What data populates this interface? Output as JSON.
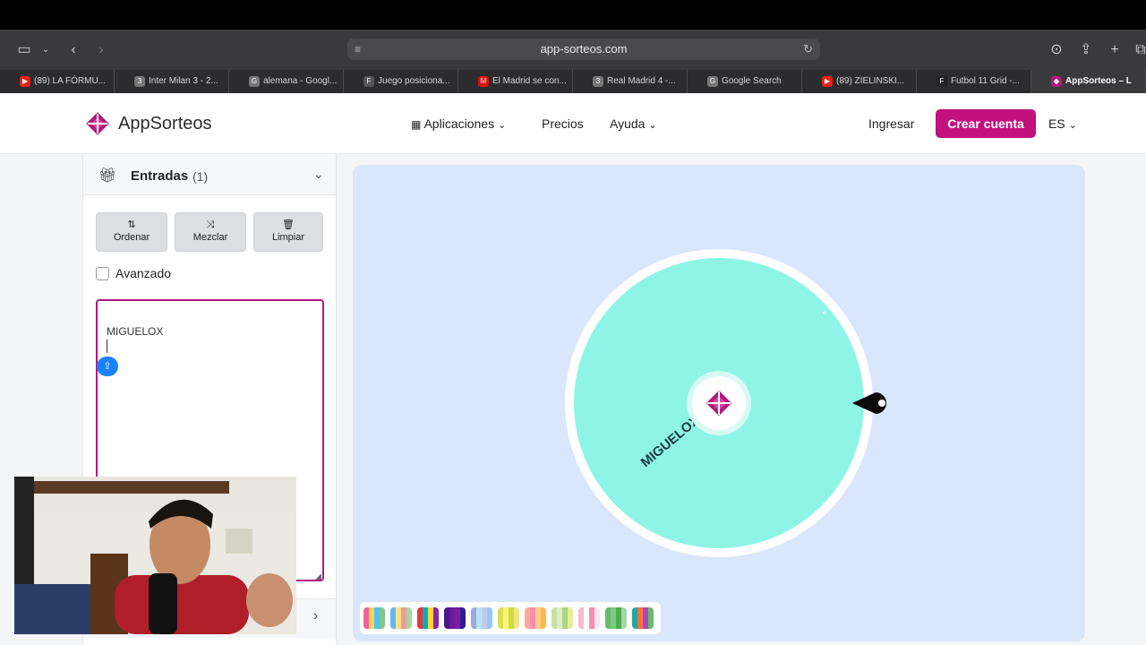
{
  "browser": {
    "url": "app-sorteos.com",
    "tabs": [
      {
        "label": "(89) LA FÓRMU...",
        "fav": "▶",
        "favColor": "#e62117"
      },
      {
        "label": "Inter Milan 3 - 2...",
        "fav": "3",
        "favColor": "#777"
      },
      {
        "label": "alemana - Googl...",
        "fav": "G",
        "favColor": "#777"
      },
      {
        "label": "Juego posiciona...",
        "fav": "F",
        "favColor": "#555"
      },
      {
        "label": "El Madrid se con...",
        "fav": "M",
        "favColor": "#d11"
      },
      {
        "label": "Real Madrid 4 -...",
        "fav": "3",
        "favColor": "#777"
      },
      {
        "label": "Google Search",
        "fav": "G",
        "favColor": "#777"
      },
      {
        "label": "(89) ZIELINSKI...",
        "fav": "▶",
        "favColor": "#e62117"
      },
      {
        "label": "Futbol 11 Grid -...",
        "fav": "F",
        "favColor": "#222"
      },
      {
        "label": "AppSorteos – L",
        "fav": "◆",
        "favColor": "#b0187e"
      }
    ]
  },
  "header": {
    "logo": "AppSorteos",
    "nav": {
      "apps": "Aplicaciones",
      "pricing": "Precios",
      "help": "Ayuda"
    },
    "login": "Ingresar",
    "create_account": "Crear cuenta",
    "lang": "ES"
  },
  "panel": {
    "title": "Entradas",
    "count": "(1)",
    "buttons": {
      "sort": "Ordenar",
      "shuffle": "Mezclar",
      "clear": "Limpiar"
    },
    "advanced": "Avanzado",
    "entries_text": "MIGUELOX"
  },
  "wheel": {
    "segment_label": "MIGUELOX",
    "segment_color": "#8ef5e6"
  },
  "palette_colors": [
    [
      "#f06292",
      "#ffd54f",
      "#4fc3f7",
      "#81c784"
    ],
    [
      "#64b5f6",
      "#ffe082",
      "#ef9a9a",
      "#a5d6a7"
    ],
    [
      "#e53935",
      "#00acc1",
      "#fdd835",
      "#8e24aa"
    ],
    [
      "#4a148c",
      "#6a1b9a",
      "#7b1fa2",
      "#311b92"
    ],
    [
      "#9fa8da",
      "#b3e5fc",
      "#c5cae9",
      "#90caf9"
    ],
    [
      "#d4e157",
      "#fff176",
      "#cddc39",
      "#f0e68c"
    ],
    [
      "#ffab91",
      "#f48fb1",
      "#ffcc80",
      "#ffb74d"
    ],
    [
      "#c5e1a5",
      "#dcedc8",
      "#aed581",
      "#e6ee9c"
    ],
    [
      "#f8bbd0",
      "#ffffff",
      "#f48fb1",
      "#fce4ec"
    ],
    [
      "#66bb6a",
      "#81c784",
      "#4caf50",
      "#a5d6a7"
    ],
    [
      "#26a69a",
      "#ff7043",
      "#ab47bc",
      "#66bb6a"
    ]
  ]
}
